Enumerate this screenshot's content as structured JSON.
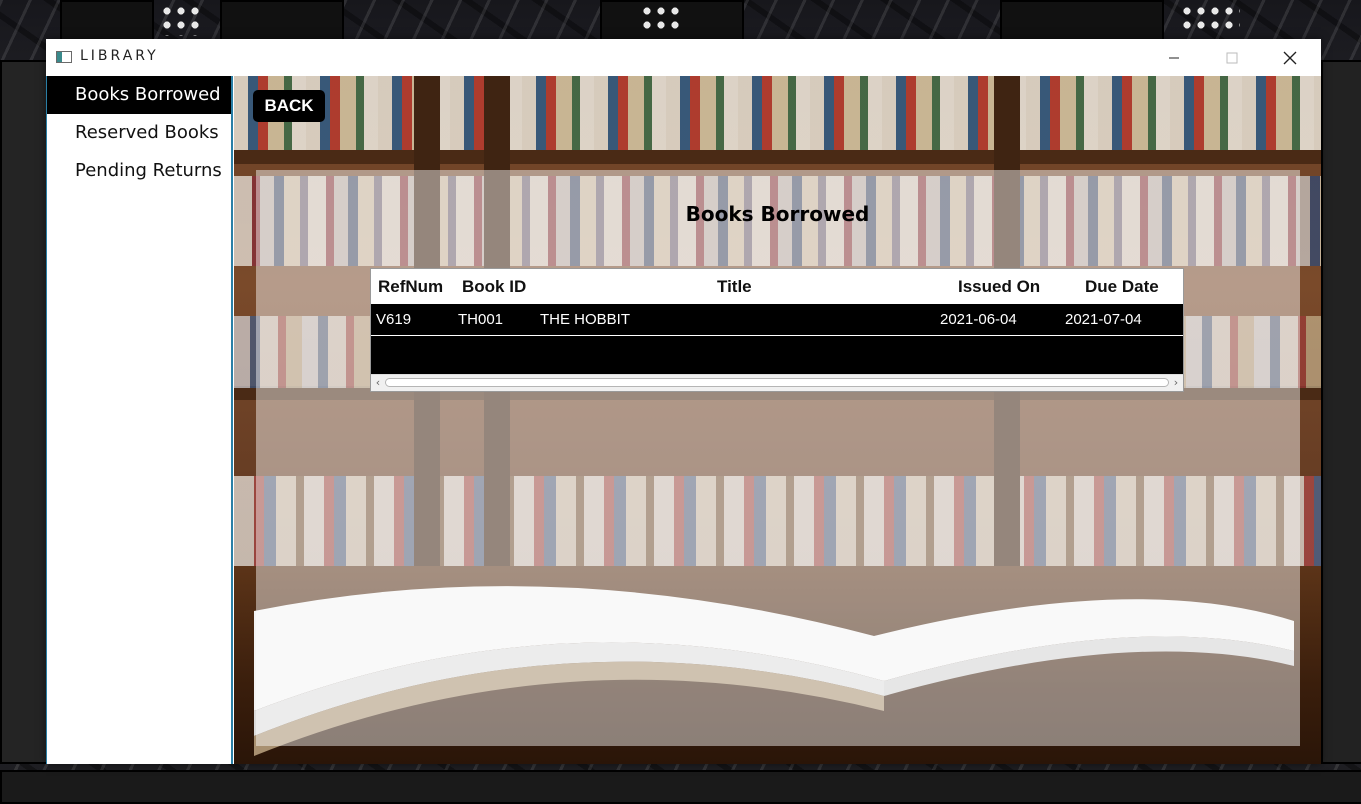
{
  "window": {
    "title": "LIBRARY"
  },
  "sidebar": {
    "items": [
      {
        "label": "Books Borrowed",
        "active": true
      },
      {
        "label": "Reserved Books",
        "active": false
      },
      {
        "label": "Pending Returns",
        "active": false
      }
    ]
  },
  "main": {
    "back_label": "BACK",
    "page_title": "Books Borrowed",
    "table": {
      "columns": [
        "RefNum",
        "Book ID",
        "Title",
        "Issued On",
        "Due Date"
      ],
      "rows": [
        [
          "V619",
          "TH001",
          "THE HOBBIT",
          "2021-06-04",
          "2021-07-04"
        ]
      ]
    }
  },
  "colors": {
    "sidebar_active_bg": "#000000",
    "table_bg": "#000000",
    "sidebar_border": "#2a7fa6"
  }
}
